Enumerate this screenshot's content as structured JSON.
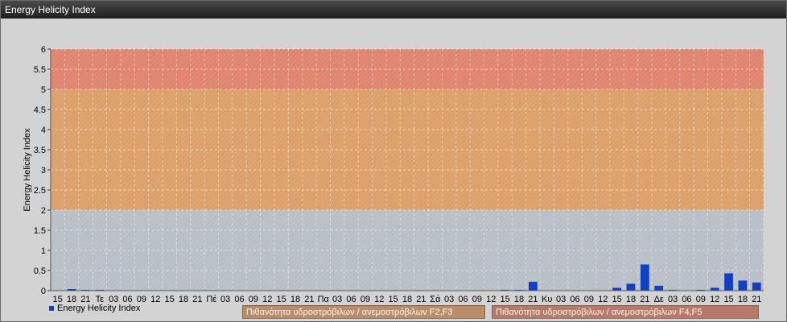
{
  "window": {
    "title": "Energy Helicity Index"
  },
  "legend": {
    "series_label": "Energy Helicity Index",
    "band_f2f3": "Πιθανότητα υδροστρόβιλων / ανεμοστρόβιλων F2,F3",
    "band_f4f5": "Πιθανότητα υδροστρόβιλων / ανεμοστρόβιλων F4,F5"
  },
  "colors": {
    "bar": "#1040c8",
    "band_low": "#b9bfc6",
    "band_mid": "#dca06a",
    "band_high": "#e08470",
    "plot_bg": "#c8c8c8"
  },
  "chart_data": {
    "type": "bar",
    "title": "",
    "xlabel": "",
    "ylabel": "Energy Helicity Index",
    "ylim": [
      0,
      6
    ],
    "yticks": [
      "0",
      "0.5",
      "1",
      "1.5",
      "2",
      "2.5",
      "3",
      "3.5",
      "4",
      "4.5",
      "5",
      "5.5",
      "6"
    ],
    "bands": [
      {
        "from": 0,
        "to": 2,
        "color": "#b9bfc6"
      },
      {
        "from": 2,
        "to": 5,
        "color": "#dca06a"
      },
      {
        "from": 5,
        "to": 6,
        "color": "#e08470"
      }
    ],
    "grid": true,
    "categories": [
      "15",
      "18",
      "21",
      "Τε",
      "03",
      "06",
      "09",
      "12",
      "15",
      "18",
      "21",
      "Πέ",
      "03",
      "06",
      "09",
      "12",
      "15",
      "18",
      "21",
      "Πα",
      "03",
      "06",
      "09",
      "12",
      "15",
      "18",
      "21",
      "Σά",
      "03",
      "06",
      "09",
      "12",
      "15",
      "18",
      "21",
      "Κυ",
      "03",
      "06",
      "09",
      "12",
      "15",
      "18",
      "21",
      "Δε",
      "03",
      "06",
      "09",
      "12",
      "15",
      "18",
      "21"
    ],
    "series": [
      {
        "values": [
          0.01,
          0.04,
          0.02,
          0.02,
          0.01,
          0.01,
          0.01,
          0.01,
          0.01,
          0.01,
          0.01,
          0.01,
          0.01,
          0.01,
          0.01,
          0.01,
          0.01,
          0.01,
          0.01,
          0.01,
          0.01,
          0.01,
          0.01,
          0.01,
          0.01,
          0.01,
          0.01,
          0.01,
          0.01,
          0.01,
          0.01,
          0.01,
          0.02,
          0.02,
          0.22,
          0.01,
          0.01,
          0.01,
          0.01,
          0.01,
          0.07,
          0.17,
          0.65,
          0.12,
          0.02,
          0.01,
          0.02,
          0.07,
          0.43,
          0.25,
          0.2
        ]
      }
    ]
  }
}
